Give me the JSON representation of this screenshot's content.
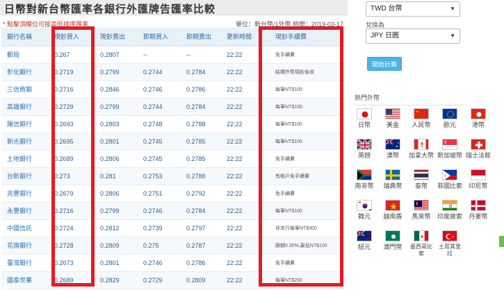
{
  "page": {
    "title": "日幣對新台幣匯率各銀行外匯牌告匯率比較",
    "note": "* 點擊頂欄位可按高低排序匯率",
    "unit_info": "單位：新台幣/1外幣  時間：2019-03-17"
  },
  "table": {
    "headers": [
      "銀行名稱",
      "現鈔買入",
      "現鈔賣出",
      "即期買入",
      "即期賣出",
      "更新時間",
      "現鈔手續費"
    ],
    "rows": [
      [
        "郵局",
        "0.267",
        "0.2807",
        "--",
        "--",
        "22:22",
        "免手續費"
      ],
      [
        "彰化銀行",
        "0.2719",
        "0.2799",
        "0.2744",
        "0.2784",
        "22:22",
        "結構外幣現鈔免收"
      ],
      [
        "三信商銀",
        "0.2716",
        "0.2846",
        "0.2746",
        "0.2786",
        "22:22",
        "每筆NT$100"
      ],
      [
        "高雄銀行",
        "0.2729",
        "0.2799",
        "0.2744",
        "0.2784",
        "22:22",
        "每筆NT$100"
      ],
      [
        "陽信銀行",
        "0.2693",
        "0.2803",
        "0.2748",
        "0.2788",
        "22:22",
        "每筆NT$100"
      ],
      [
        "新光銀行",
        "0.2695",
        "0.2801",
        "0.2745",
        "0.2785",
        "22:22",
        "每筆NT$100"
      ],
      [
        "土地銀行",
        "0.2689",
        "0.2806",
        "0.2745",
        "0.2785",
        "22:22",
        "免手續費"
      ],
      [
        "台新銀行",
        "0.273",
        "0.281",
        "0.2753",
        "0.2788",
        "22:22",
        "有帳戶免手續費"
      ],
      [
        "兆豐銀行",
        "0.2679",
        "0.2806",
        "0.2751",
        "0.2792",
        "22:22",
        "免手續費"
      ],
      [
        "永豐銀行",
        "0.2716",
        "0.2799",
        "0.2746",
        "0.2784",
        "22:22",
        "每筆NT$100"
      ],
      [
        "中國信託",
        "0.2724",
        "0.2812",
        "0.2739",
        "0.2797",
        "22:22",
        "非本行每筆NT$300"
      ],
      [
        "花旗銀行",
        "0.2728",
        "0.2809",
        "0.275",
        "0.2787",
        "22:22",
        "跟額0.35%,最低NT$100"
      ],
      [
        "臺灣銀行",
        "0.2673",
        "0.2801",
        "0.2746",
        "0.2786",
        "22:22",
        "免手續費"
      ],
      [
        "國泰世華",
        "0.2689",
        "0.2829",
        "0.2729",
        "0.2809",
        "22:22",
        "每筆NT$200"
      ]
    ]
  },
  "converter": {
    "from_currency": "TWD 台幣",
    "to_label": "兌換為",
    "to_currency": "JPY 日圓",
    "calc_button": "開始計算"
  },
  "hot": {
    "title": "熱門外幣",
    "currencies": [
      {
        "label": "日幣",
        "icon": "japan-flag-icon"
      },
      {
        "label": "美金",
        "icon": "usa-flag-icon"
      },
      {
        "label": "人民幣",
        "icon": "china-flag-icon"
      },
      {
        "label": "歐元",
        "icon": "eu-flag-icon"
      },
      {
        "label": "港幣",
        "icon": "hong-kong-flag-icon"
      },
      {
        "label": "英鎊",
        "icon": "uk-flag-icon"
      },
      {
        "label": "澳幣",
        "icon": "australia-flag-icon"
      },
      {
        "label": "加拿大幣",
        "icon": "canada-flag-icon"
      },
      {
        "label": "新加坡幣",
        "icon": "singapore-flag-icon"
      },
      {
        "label": "瑞士法郎",
        "icon": "switzerland-flag-icon"
      },
      {
        "label": "南非幣",
        "icon": "south-africa-flag-icon"
      },
      {
        "label": "瑞典幣",
        "icon": "sweden-flag-icon"
      },
      {
        "label": "泰幣",
        "icon": "thailand-flag-icon"
      },
      {
        "label": "菲國比索",
        "icon": "philippines-flag-icon"
      },
      {
        "label": "印尼幣",
        "icon": "indonesia-flag-icon"
      },
      {
        "label": "韓元",
        "icon": "korea-flag-icon"
      },
      {
        "label": "越南盾",
        "icon": "vietnam-flag-icon"
      },
      {
        "label": "馬來幣",
        "icon": "malaysia-flag-icon"
      },
      {
        "label": "印度披索",
        "icon": "india-flag-icon"
      },
      {
        "label": "丹麥幣",
        "icon": "denmark-flag-icon"
      },
      {
        "label": "紐元",
        "icon": "new-zealand-flag-icon"
      },
      {
        "label": "澳門幣",
        "icon": "macau-flag-icon"
      },
      {
        "label": "墨西哥比索",
        "icon": "mexico-flag-icon"
      },
      {
        "label": "土耳其里拉",
        "icon": "turkey-flag-icon"
      }
    ]
  },
  "colors": {
    "highlight": "#e31b23",
    "header_bg": "#e9f1f8",
    "link": "#2a6fb5",
    "button": "#4bb3ea"
  }
}
